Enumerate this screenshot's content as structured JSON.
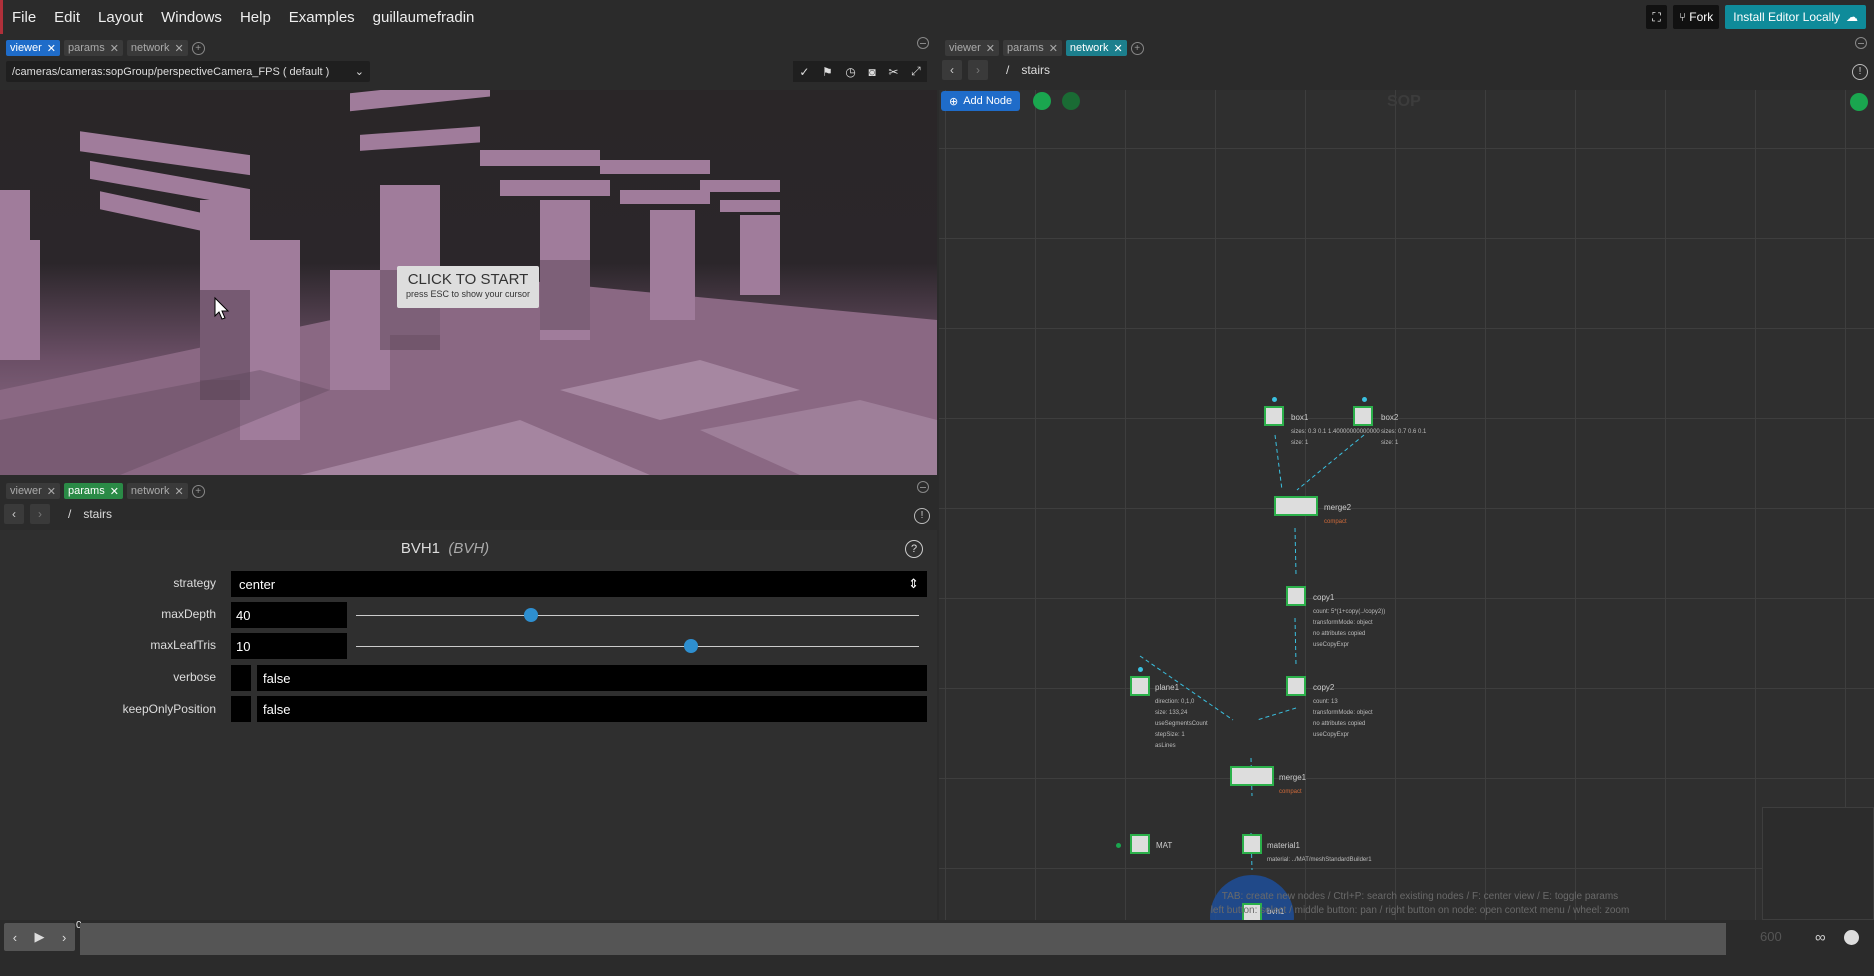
{
  "menu": {
    "items": [
      "File",
      "Edit",
      "Layout",
      "Windows",
      "Help",
      "Examples",
      "guillaumefradin"
    ],
    "fork_label": "Fork",
    "install_label": "Install Editor Locally"
  },
  "left_top_panel": {
    "tabs": [
      "viewer",
      "params",
      "network"
    ],
    "camera_path": "/cameras/cameras:sopGroup/perspectiveCamera_FPS ( default )",
    "overlay_title": "CLICK TO START",
    "overlay_sub": "press ESC to show your cursor"
  },
  "left_bottom_panel": {
    "tabs": [
      "viewer",
      "params",
      "network"
    ],
    "path_root": "/",
    "path_name": "stairs",
    "node_name": "BVH1",
    "node_type": "(BVH)",
    "params": {
      "strategy": {
        "label": "strategy",
        "value": "center"
      },
      "maxDepth": {
        "label": "maxDepth",
        "value": "40",
        "fraction": 0.31
      },
      "maxLeafTris": {
        "label": "maxLeafTris",
        "value": "10",
        "fraction": 0.595
      },
      "verbose": {
        "label": "verbose",
        "value": "false"
      },
      "keepOnlyPosition": {
        "label": "keepOnlyPosition",
        "value": "false"
      }
    }
  },
  "right_panel": {
    "tabs": [
      "viewer",
      "params",
      "network"
    ],
    "path_root": "/",
    "path_name": "stairs",
    "add_node_label": "Add Node",
    "context_label": "SOP",
    "nodes": {
      "box1": {
        "label": "box1",
        "info": [
          "sizes: 0.3 0.1 1.40000000000000",
          "size: 1"
        ]
      },
      "box2": {
        "label": "box2",
        "info": [
          "sizes: 0.7 0.6 0.1",
          "size: 1"
        ]
      },
      "merge2": {
        "label": "merge2",
        "info": [
          "compact"
        ]
      },
      "copy1": {
        "label": "copy1",
        "info": [
          "count: 5*(1+copy(../copy2))",
          "transformMode: object",
          "no attributes copied",
          "useCopyExpr"
        ]
      },
      "copy2": {
        "label": "copy2",
        "info": [
          "count: 13",
          "transformMode: object",
          "no attributes copied",
          "useCopyExpr"
        ]
      },
      "plane1": {
        "label": "plane1",
        "info": [
          "direction: 0,1,0",
          "size: 133,24",
          "useSegmentsCount",
          "stepSize: 1",
          "asLines"
        ]
      },
      "merge1": {
        "label": "merge1",
        "info": [
          "compact"
        ]
      },
      "material1": {
        "label": "material1",
        "info": [
          "material: ../MAT/meshStandardBuilder1"
        ]
      },
      "MAT": {
        "label": "MAT"
      },
      "bvh": {
        "label": "bvh1"
      }
    },
    "hint_line1": "TAB: create new nodes / Ctrl+P: search existing nodes / F: center view / E: toggle params",
    "hint_line2": "left button: select / middle button: pan / right button on node: open context menu / wheel: zoom"
  },
  "timeline": {
    "frame": "0",
    "end_frame": "600"
  },
  "colors": {
    "accent_blue": "#1f6cc9",
    "params_green": "#2a8a46",
    "network_teal": "#1c7f8d",
    "node_border": "#2bb04a"
  }
}
